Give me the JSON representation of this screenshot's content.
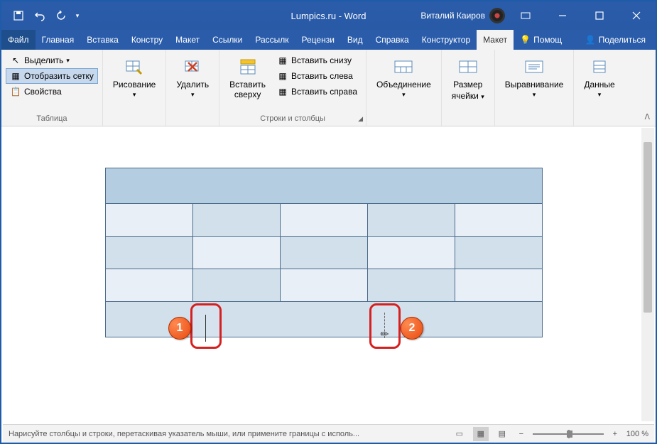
{
  "title": "Lumpics.ru  -  Word",
  "user": "Виталий Каиров",
  "tabs": {
    "file": "Файл",
    "items": [
      "Главная",
      "Вставка",
      "Констру",
      "Макет",
      "Ссылки",
      "Рассылк",
      "Рецензи",
      "Вид",
      "Справка",
      "Конструктор"
    ],
    "active": "Макет",
    "help": "Помощ",
    "share": "Поделиться"
  },
  "ribbon": {
    "table": {
      "select": "Выделить",
      "grid": "Отобразить сетку",
      "props": "Свойства",
      "label": "Таблица"
    },
    "draw": {
      "draw": "Рисование",
      "label": ""
    },
    "delete": {
      "btn": "Удалить",
      "label": ""
    },
    "rowscols": {
      "insert_above": "Вставить\nсверху",
      "insert_below": "Вставить снизу",
      "insert_left": "Вставить слева",
      "insert_right": "Вставить справа",
      "label": "Строки и столбцы"
    },
    "merge": {
      "btn": "Объединение",
      "label": ""
    },
    "cellsize": {
      "line1": "Размер",
      "line2": "ячейки",
      "label": ""
    },
    "align": {
      "btn": "Выравнивание",
      "label": ""
    },
    "data": {
      "btn": "Данные",
      "label": ""
    }
  },
  "status": {
    "text": "Нарисуйте столбцы и строки, перетаскивая указатель мыши, или примените границы с исполь...",
    "zoom": "100 %"
  },
  "callouts": {
    "b1": "1",
    "b2": "2"
  }
}
